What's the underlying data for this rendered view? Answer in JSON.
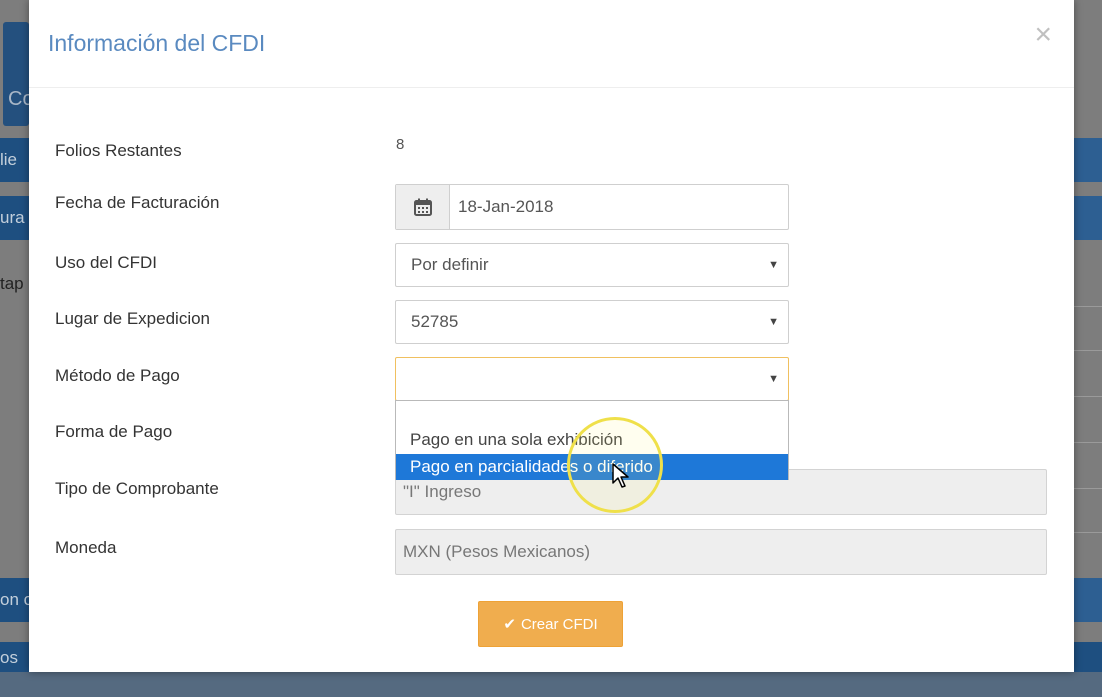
{
  "background": {
    "tile_text": "Co",
    "bars": [
      {
        "text": "lie"
      },
      {
        "text": "ura"
      },
      {
        "text": "on c"
      },
      {
        "text": "os"
      }
    ],
    "side_text": "tap"
  },
  "modal": {
    "title": "Información del CFDI",
    "close_label": "×"
  },
  "form": {
    "folios": {
      "label": "Folios Restantes",
      "value": "8"
    },
    "fecha": {
      "label": "Fecha de Facturación",
      "value": "18-Jan-2018",
      "icon": "calendar-icon"
    },
    "uso": {
      "label": "Uso del CFDI",
      "value": "Por definir"
    },
    "lugar": {
      "label": "Lugar de Expedicion",
      "value": "52785"
    },
    "metodo": {
      "label": "Método de Pago",
      "value": "",
      "options": [
        "Pago en una sola exhibición",
        "Pago en parcialidades o diferido"
      ],
      "highlighted_option": "Pago en parcialidades o diferido"
    },
    "forma": {
      "label": "Forma de Pago"
    },
    "tipo": {
      "label": "Tipo de Comprobante",
      "value": "\"I\" Ingreso"
    },
    "moneda": {
      "label": "Moneda",
      "value": "MXN (Pesos Mexicanos)"
    }
  },
  "actions": {
    "create_label": "Crear CFDI",
    "create_icon": "check-icon"
  },
  "colors": {
    "title": "#5a8ac0",
    "button": "#f0ad4e",
    "highlight": "#1e78d8",
    "bg_bar": "#1e4f80"
  }
}
